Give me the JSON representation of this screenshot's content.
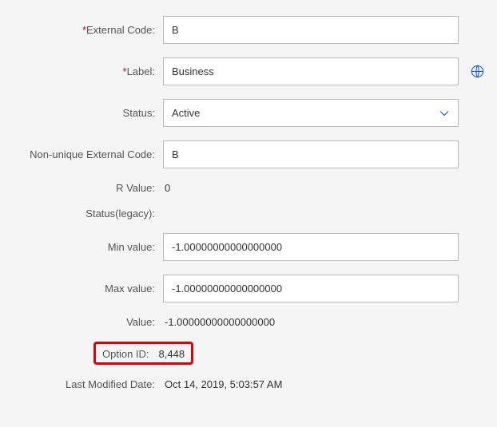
{
  "form": {
    "externalCode": {
      "label": "External Code:",
      "required": true,
      "value": "B"
    },
    "label": {
      "label": "Label:",
      "required": true,
      "value": "Business"
    },
    "status": {
      "label": "Status:",
      "selected": "Active"
    },
    "nonUniqueExternalCode": {
      "label": "Non-unique External Code:",
      "value": "B"
    },
    "rValue": {
      "label": "R Value:",
      "value": "0"
    },
    "statusLegacy": {
      "label": "Status(legacy):",
      "value": ""
    },
    "minValue": {
      "label": "Min value:",
      "value": "-1.00000000000000000"
    },
    "maxValue": {
      "label": "Max value:",
      "value": "-1.00000000000000000"
    },
    "value": {
      "label": "Value:",
      "value": "-1.00000000000000000"
    },
    "optionId": {
      "label": "Option ID:",
      "value": "8,448"
    },
    "lastModifiedDate": {
      "label": "Last Modified Date:",
      "value": "Oct 14, 2019, 5:03:57 AM"
    }
  }
}
